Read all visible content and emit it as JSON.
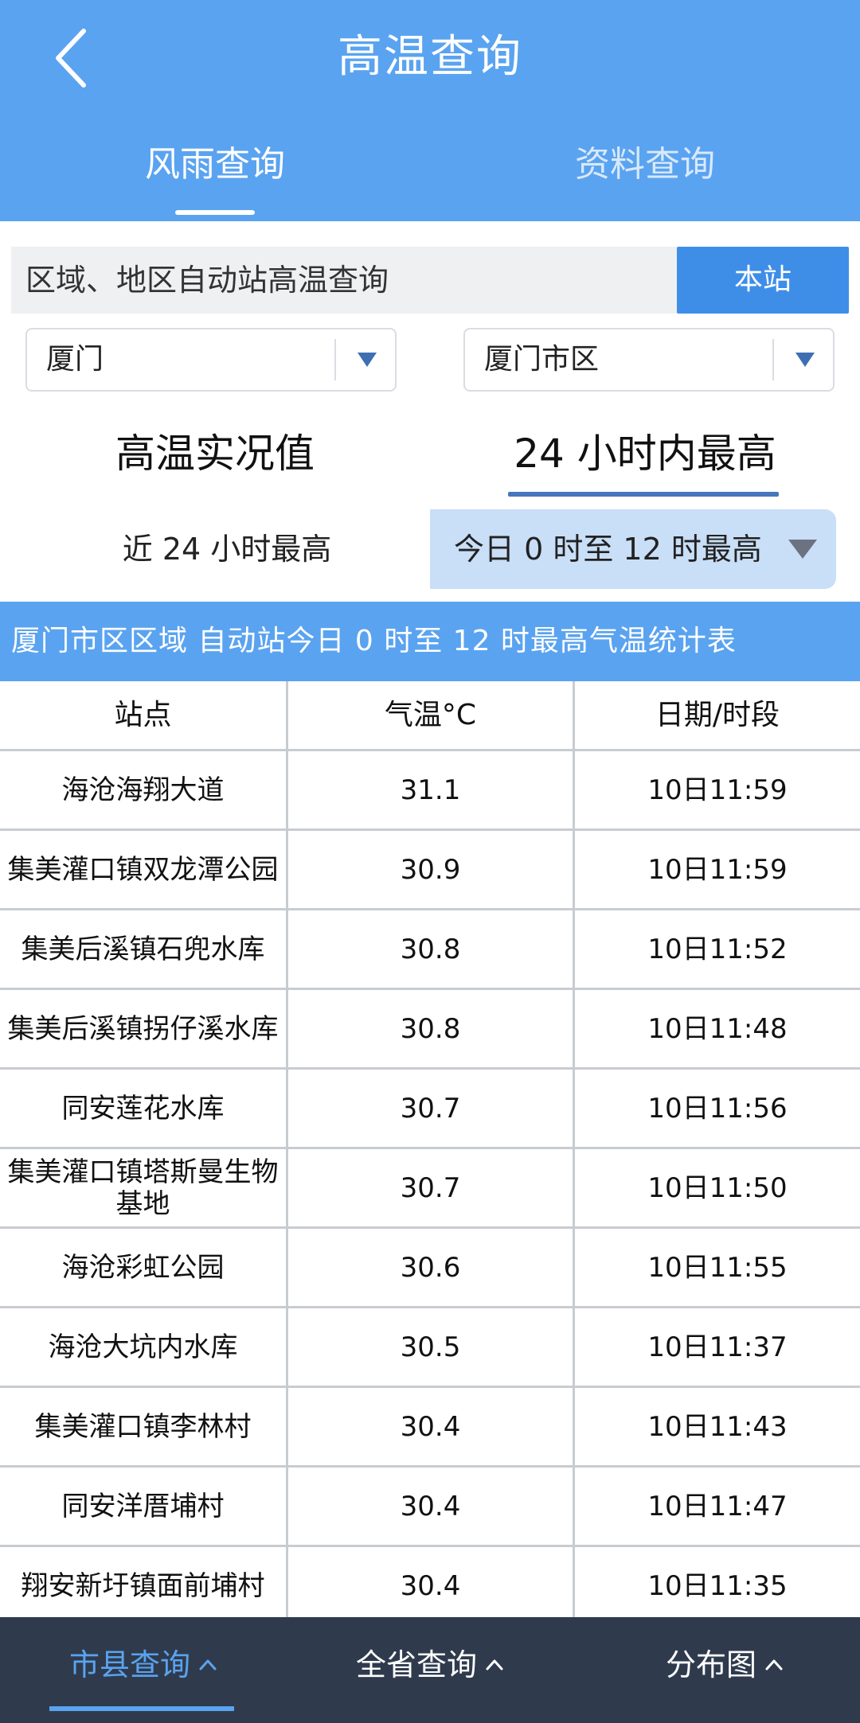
{
  "header": {
    "title": "高温查询",
    "tabs": [
      {
        "label": "风雨查询",
        "active": true
      },
      {
        "label": "资料查询",
        "active": false
      }
    ]
  },
  "query": {
    "text": "区域、地区自动站高温查询",
    "station_button": "本站"
  },
  "selects": {
    "city": "厦门",
    "area": "厦门市区"
  },
  "modes": {
    "realtime": "高温实况值",
    "max24": "24 小时内最高"
  },
  "range": {
    "left": "近 24 小时最高",
    "right": "今日 0 时至 12 时最高"
  },
  "table": {
    "title": "厦门市区区域 自动站今日 0 时至 12 时最高气温统计表",
    "headers": [
      "站点",
      "气温°C",
      "日期/时段"
    ],
    "rows": [
      {
        "station": "海沧海翔大道",
        "temp": "31.1",
        "time": "10日11:59"
      },
      {
        "station": "集美灌口镇双龙潭公园",
        "temp": "30.9",
        "time": "10日11:59"
      },
      {
        "station": "集美后溪镇石兜水库",
        "temp": "30.8",
        "time": "10日11:52"
      },
      {
        "station": "集美后溪镇拐仔溪水库",
        "temp": "30.8",
        "time": "10日11:48"
      },
      {
        "station": "同安莲花水库",
        "temp": "30.7",
        "time": "10日11:56"
      },
      {
        "station": "集美灌口镇塔斯曼生物基地",
        "temp": "30.7",
        "time": "10日11:50"
      },
      {
        "station": "海沧彩虹公园",
        "temp": "30.6",
        "time": "10日11:55"
      },
      {
        "station": "海沧大坑内水库",
        "temp": "30.5",
        "time": "10日11:37"
      },
      {
        "station": "集美灌口镇李林村",
        "temp": "30.4",
        "time": "10日11:43"
      },
      {
        "station": "同安洋厝埔村",
        "temp": "30.4",
        "time": "10日11:47"
      },
      {
        "station": "翔安新圩镇面前埔村",
        "temp": "30.4",
        "time": "10日11:35"
      }
    ]
  },
  "bottom_nav": {
    "city": "市县查询",
    "province": "全省查询",
    "map": "分布图"
  },
  "colors": {
    "header_blue": "#5aa3f0",
    "button_blue": "#3e8ee8",
    "nav_dark": "#2f3b4d"
  }
}
